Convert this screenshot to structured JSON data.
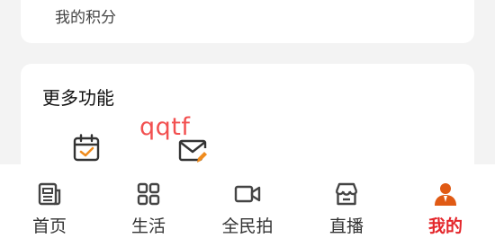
{
  "points_card": {
    "label": "我的积分"
  },
  "more_functions": {
    "title": "更多功能",
    "items": [
      {
        "icon": "calendar-check-icon"
      },
      {
        "icon": "mail-edit-icon"
      }
    ]
  },
  "overlay_text": "qqtf",
  "tabbar": {
    "active_color": "#e4262b",
    "items": [
      {
        "label": "首页",
        "icon": "news-icon"
      },
      {
        "label": "生活",
        "icon": "grid-icon"
      },
      {
        "label": "全民拍",
        "icon": "video-camera-icon"
      },
      {
        "label": "直播",
        "icon": "store-icon"
      },
      {
        "label": "我的",
        "icon": "user-icon",
        "active": true
      }
    ]
  }
}
